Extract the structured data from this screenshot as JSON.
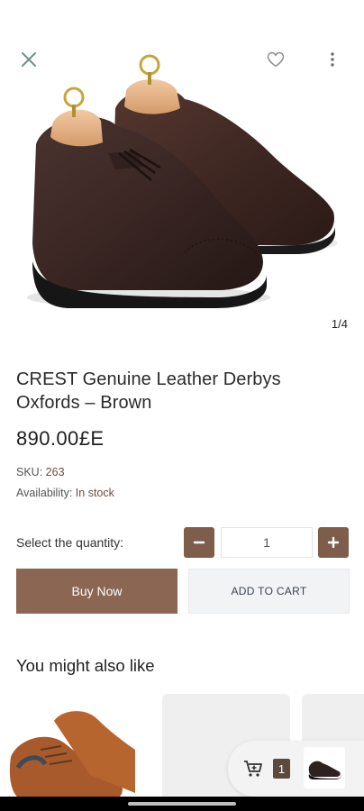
{
  "gallery": {
    "counter": "1/4",
    "close_icon": "close-icon",
    "favorite_icon": "heart-outline-icon",
    "more_icon": "more-vertical-icon"
  },
  "product": {
    "title": "CREST Genuine Leather Derbys Oxfords – Brown",
    "price": "890.00£E",
    "sku_label": "SKU:",
    "sku_value": "263",
    "availability_label": "Availability:",
    "availability_value": "In stock"
  },
  "quantity": {
    "label": "Select the quantity:",
    "value": "1",
    "minus_icon": "minus-icon",
    "plus_icon": "plus-icon"
  },
  "actions": {
    "buy_now": "Buy Now",
    "add_to_cart": "ADD TO CART"
  },
  "recommendations": {
    "title": "You might also like"
  },
  "mini_cart": {
    "count": "1",
    "icon": "cart-add-icon"
  },
  "colors": {
    "accent": "#8a6653",
    "accent_dark": "#7f5d4b",
    "badge": "#5d4a3f",
    "availability": "#6b4d3e"
  }
}
